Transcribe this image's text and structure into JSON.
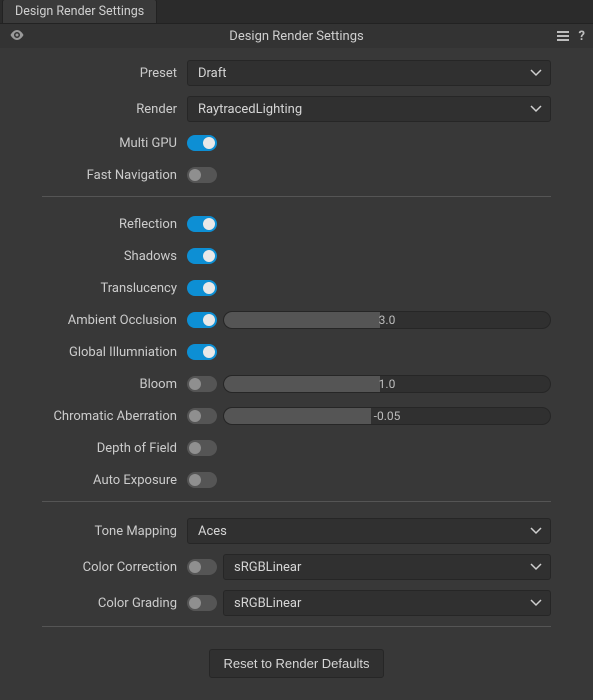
{
  "tab": {
    "title": "Design Render Settings"
  },
  "header": {
    "title": "Design Render Settings"
  },
  "preset": {
    "label": "Preset",
    "value": "Draft"
  },
  "render": {
    "label": "Render",
    "value": "RaytracedLighting"
  },
  "multiGpu": {
    "label": "Multi GPU",
    "on": true
  },
  "fastNav": {
    "label": "Fast Navigation",
    "on": false
  },
  "reflection": {
    "label": "Reflection",
    "on": true
  },
  "shadows": {
    "label": "Shadows",
    "on": true
  },
  "translucency": {
    "label": "Translucency",
    "on": true
  },
  "ao": {
    "label": "Ambient Occlusion",
    "on": true,
    "value": "3.0",
    "fillPct": 48
  },
  "gi": {
    "label": "Global Illumniation",
    "on": true
  },
  "bloom": {
    "label": "Bloom",
    "on": false,
    "value": "1.0",
    "fillPct": 48
  },
  "chroma": {
    "label": "Chromatic Aberration",
    "on": false,
    "value": "-0.05",
    "fillPct": 45
  },
  "dof": {
    "label": "Depth of Field",
    "on": false
  },
  "autoExp": {
    "label": "Auto Exposure",
    "on": false
  },
  "toneMap": {
    "label": "Tone Mapping",
    "value": "Aces"
  },
  "colorCorr": {
    "label": "Color Correction",
    "on": false,
    "value": "sRGBLinear"
  },
  "colorGrade": {
    "label": "Color Grading",
    "on": false,
    "value": "sRGBLinear"
  },
  "resetBtn": {
    "label": "Reset to Render Defaults"
  }
}
